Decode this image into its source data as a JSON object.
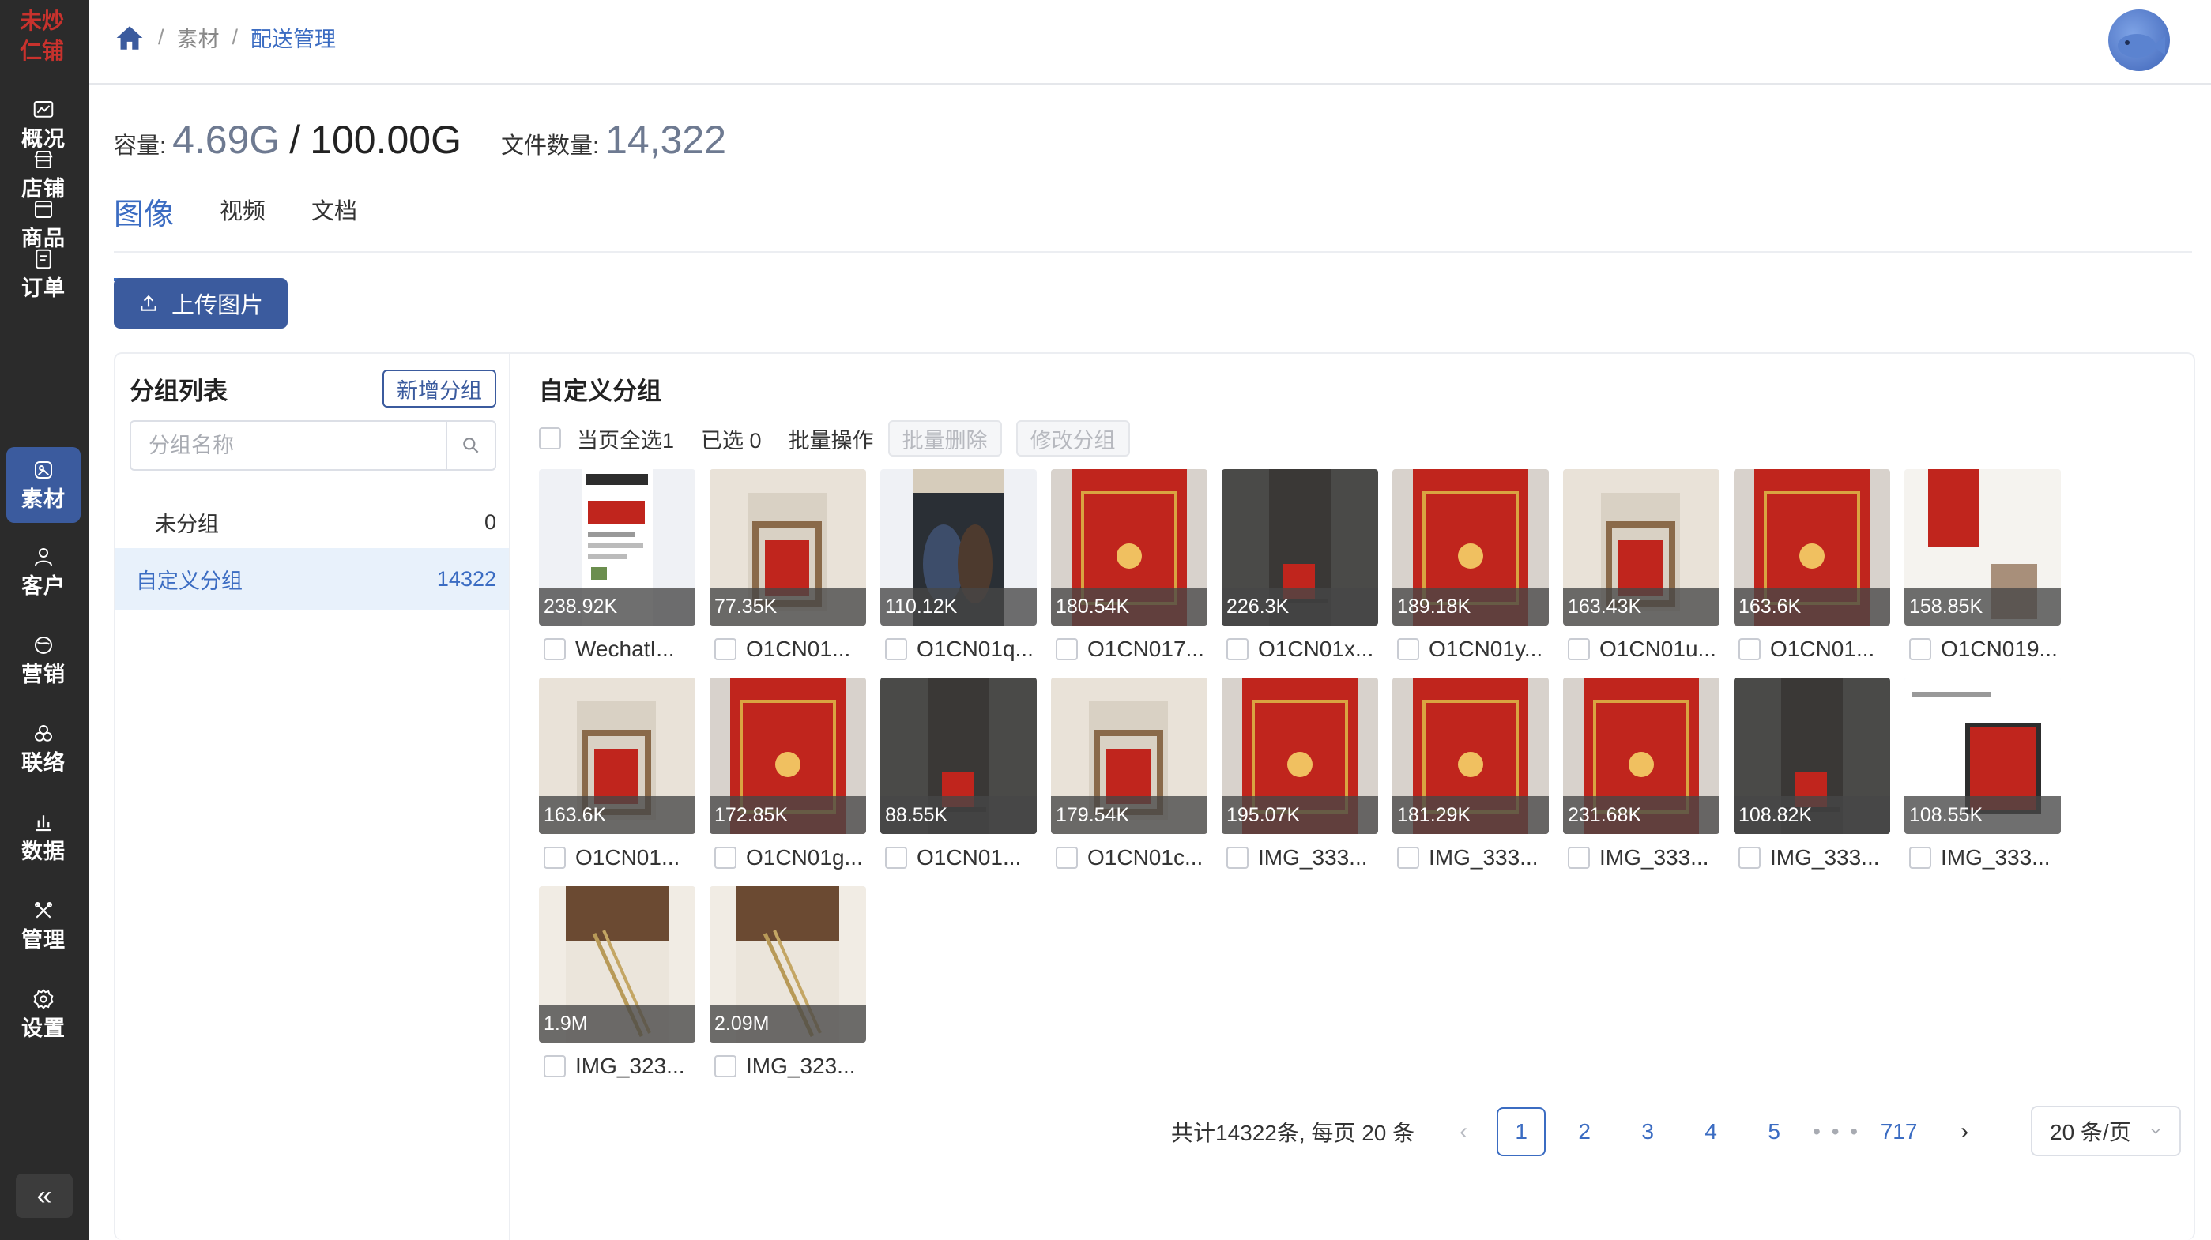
{
  "sidebar": {
    "logo_text": "未炒仁铺",
    "items": [
      {
        "label": "概况",
        "icon": "chart-icon"
      },
      {
        "label": "店铺",
        "icon": "store-icon"
      },
      {
        "label": "商品",
        "icon": "box-icon"
      },
      {
        "label": "订单",
        "icon": "document-icon"
      },
      {
        "label": "素材",
        "icon": "image-icon"
      },
      {
        "label": "客户",
        "icon": "user-icon"
      },
      {
        "label": "营销",
        "icon": "megaphone-icon"
      },
      {
        "label": "联络",
        "icon": "network-icon"
      },
      {
        "label": "数据",
        "icon": "bar-chart-icon"
      },
      {
        "label": "管理",
        "icon": "tools-icon"
      },
      {
        "label": "设置",
        "icon": "settings-icon"
      }
    ],
    "active_item": "素材",
    "collapse_icon": "«"
  },
  "header": {
    "breadcrumb": [
      "素材",
      "配送管理"
    ],
    "breadcrumb_separator": "/"
  },
  "capacity": {
    "label": "容量:",
    "used": "4.69G",
    "separator": "/",
    "total": "100.00G",
    "files_label": "文件数量:",
    "files_count": "14,322"
  },
  "tabs": [
    {
      "label": "图像",
      "active": true
    },
    {
      "label": "视频",
      "active": false
    },
    {
      "label": "文档",
      "active": false
    }
  ],
  "upload_button": "上传图片",
  "groups": {
    "title": "分组列表",
    "new_button": "新增分组",
    "search_placeholder": "分组名称",
    "items": [
      {
        "name": "未分组",
        "count": "0"
      },
      {
        "name": "自定义分组",
        "count": "14322"
      }
    ]
  },
  "content": {
    "title": "自定义分组",
    "select_all": "当页全选1",
    "selected": "已选 0",
    "batch_label": "批量操作",
    "batch_delete": "批量删除",
    "change_group": "修改分组"
  },
  "images": [
    {
      "size": "238.92K",
      "name": "WechatI..."
    },
    {
      "size": "77.35K",
      "name": "O1CN01..."
    },
    {
      "size": "110.12K",
      "name": "O1CN01q..."
    },
    {
      "size": "180.54K",
      "name": "O1CN017..."
    },
    {
      "size": "226.3K",
      "name": "O1CN01x..."
    },
    {
      "size": "189.18K",
      "name": "O1CN01y..."
    },
    {
      "size": "163.43K",
      "name": "O1CN01u..."
    },
    {
      "size": "163.6K",
      "name": "O1CN01..."
    },
    {
      "size": "158.85K",
      "name": "O1CN019..."
    },
    {
      "size": "163.6K",
      "name": "O1CN01..."
    },
    {
      "size": "172.85K",
      "name": "O1CN01g..."
    },
    {
      "size": "88.55K",
      "name": "O1CN01..."
    },
    {
      "size": "179.54K",
      "name": "O1CN01c..."
    },
    {
      "size": "195.07K",
      "name": "IMG_333..."
    },
    {
      "size": "181.29K",
      "name": "IMG_333..."
    },
    {
      "size": "231.68K",
      "name": "IMG_333..."
    },
    {
      "size": "108.82K",
      "name": "IMG_333..."
    },
    {
      "size": "108.55K",
      "name": "IMG_333..."
    },
    {
      "size": "1.9M",
      "name": "IMG_323..."
    },
    {
      "size": "2.09M",
      "name": "IMG_323..."
    }
  ],
  "pagination": {
    "total_text": "共计14322条, 每页 20 条",
    "pages": [
      "1",
      "2",
      "3",
      "4",
      "5"
    ],
    "ellipsis": "• • •",
    "last_page": "717",
    "current_page": "1",
    "page_size": "20 条/页",
    "prev_icon": "‹",
    "next_icon": "›"
  },
  "colors": {
    "sidebar_bg": "#2b2b2b",
    "accent": "#3b5b9e",
    "link": "#3b6cc2",
    "selected_bg": "#e8f1fb",
    "product_red": "#c0251d"
  }
}
